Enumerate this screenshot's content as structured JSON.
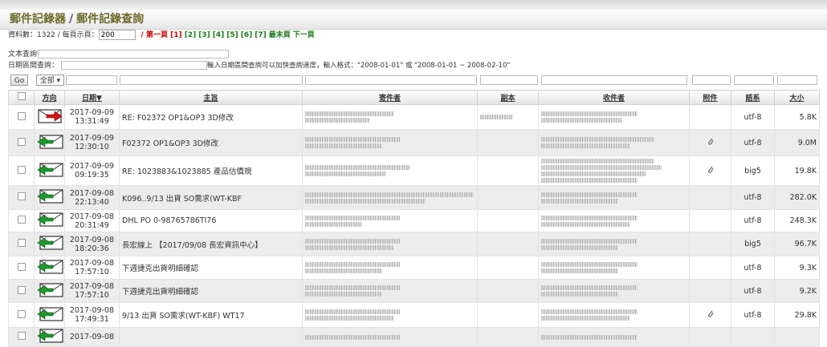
{
  "title": {
    "app": "郵件記錄器",
    "separator": "/",
    "page": "郵件記錄查詢"
  },
  "summary": {
    "count_label": "資料數：1322 / 每頁示頁：",
    "per_page_value": "200"
  },
  "pager": {
    "first_label": "/ 第一頁",
    "current": "[1]",
    "pages": [
      "[2]",
      "[3]",
      "[4]",
      "[5]",
      "[6]",
      "[7]"
    ],
    "last": "最末頁",
    "next": "下一頁"
  },
  "filters": {
    "text_label": "文本查詢：",
    "date_label": "日期區間查詢：",
    "date_hint": "輸入日期區間查詢可以加快查詢速度，輸入格式：\"2008-01-01\" 或 \"2008-01-01 ~ 2008-02-10\""
  },
  "toolbar": {
    "go_label": "Go",
    "direction_select": "全部 ▾"
  },
  "columns": {
    "direction": "方向",
    "date": "日期",
    "subject": "主旨",
    "sender": "寄件者",
    "cc": "副本",
    "recipient": "收件者",
    "attachment": "附件",
    "encoding": "語系",
    "size": "大小",
    "sort_indicator": "▼"
  },
  "rows": [
    {
      "direction": "outgoing",
      "date": "2017-09-09",
      "time": "13:31:49",
      "subject": "RE: F02372 OP1&OP3 3D修改",
      "attachment": false,
      "encoding": "utf-8",
      "size": "5.8K"
    },
    {
      "direction": "incoming",
      "date": "2017-09-09",
      "time": "12:30:10",
      "subject": "F02372 OP1&OP3 3D修改",
      "attachment": true,
      "encoding": "utf-8",
      "size": "9.0M"
    },
    {
      "direction": "incoming",
      "date": "2017-09-09",
      "time": "09:19:35",
      "subject": "RE: 1023883&1023885 產品估價規",
      "attachment": true,
      "encoding": "big5",
      "size": "19.8K"
    },
    {
      "direction": "incoming",
      "date": "2017-09-08",
      "time": "22:13:40",
      "subject": "K096..9/13 出貨 SO需求(WT-KBF",
      "attachment": false,
      "encoding": "utf-8",
      "size": "282.0K"
    },
    {
      "direction": "incoming",
      "date": "2017-09-08",
      "time": "20:31:49",
      "subject": "DHL PO 0-98765786TI76",
      "attachment": false,
      "encoding": "utf-8",
      "size": "248.3K"
    },
    {
      "direction": "incoming",
      "date": "2017-09-08",
      "time": "18:20:36",
      "subject": "長宏線上 【2017/09/08 長宏資訊中心】",
      "attachment": false,
      "encoding": "big5",
      "size": "96.7K"
    },
    {
      "direction": "incoming",
      "date": "2017-09-08",
      "time": "17:57:10",
      "subject": "下週捷克出貨明細確認",
      "attachment": false,
      "encoding": "utf-8",
      "size": "9.3K"
    },
    {
      "direction": "incoming",
      "date": "2017-09-08",
      "time": "17:57:10",
      "subject": "下週捷克出貨明細確認",
      "attachment": false,
      "encoding": "utf-8",
      "size": "9.2K"
    },
    {
      "direction": "incoming",
      "date": "2017-09-08",
      "time": "17:49:31",
      "subject": "9/13 出貨 SO需求(WT-KBF) WT17",
      "attachment": true,
      "encoding": "utf-8",
      "size": "29.8K"
    },
    {
      "direction": "incoming",
      "date": "2017-09-08",
      "time": "",
      "subject": "",
      "attachment": false,
      "encoding": "",
      "size": ""
    }
  ]
}
